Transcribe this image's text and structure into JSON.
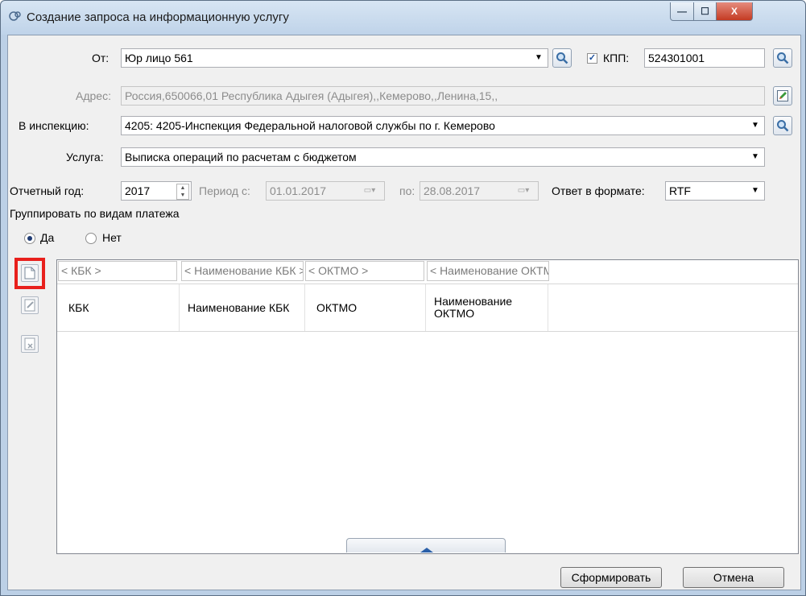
{
  "window": {
    "title": "Создание запроса на информационную услугу",
    "minimize": "—",
    "maximize": "☐",
    "close": "X"
  },
  "from": {
    "label": "От:",
    "value": "Юр лицо 561"
  },
  "kpp": {
    "checked": true,
    "label": "КПП:",
    "value": "524301001"
  },
  "address": {
    "label": "Адрес:",
    "value": "Россия,650066,01 Республика Адыгея (Адыгея),,Кемерово,,Ленина,15,,"
  },
  "inspection": {
    "label": "В инспекцию:",
    "value": "4205: 4205-Инспекция Федеральной налоговой службы по г. Кемерово"
  },
  "service": {
    "label": "Услуга:",
    "value": "Выписка операций по расчетам с бюджетом"
  },
  "year": {
    "label": "Отчетный год:",
    "value": "2017"
  },
  "period": {
    "from_label": "Период с:",
    "from_value": "01.01.2017",
    "to_label": "по:",
    "to_value": "28.08.2017"
  },
  "format": {
    "label": "Ответ в формате:",
    "value": "RTF"
  },
  "grouping": {
    "label": "Группировать по видам платежа",
    "yes": "Да",
    "no": "Нет",
    "selected": "yes"
  },
  "grid": {
    "filters": [
      "< КБК >",
      "< Наименование КБК >",
      "< ОКТМО >",
      "< Наименование ОКТМО >"
    ],
    "columns": [
      "КБК",
      "Наименование КБК",
      "ОКТМО",
      "Наименование ОКТМО"
    ],
    "rows": []
  },
  "buttons": {
    "submit": "Сформировать",
    "cancel": "Отмена"
  },
  "colors": {
    "highlight": "#e8201c",
    "titlebar": "#bfd3e9"
  }
}
